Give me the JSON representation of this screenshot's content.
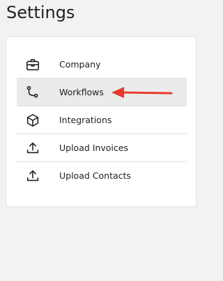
{
  "page": {
    "title": "Settings"
  },
  "menu": {
    "items": [
      {
        "label": "Company",
        "icon": "briefcase-icon"
      },
      {
        "label": "Workflows",
        "icon": "workflow-icon"
      },
      {
        "label": "Integrations",
        "icon": "cube-icon"
      },
      {
        "label": "Upload Invoices",
        "icon": "upload-icon"
      },
      {
        "label": "Upload Contacts",
        "icon": "upload-icon"
      }
    ]
  },
  "annotation": {
    "arrow_color": "#e53b28"
  },
  "colors": {
    "background": "#f2f2f2",
    "card": "#ffffff",
    "active_row": "#ebebeb"
  }
}
